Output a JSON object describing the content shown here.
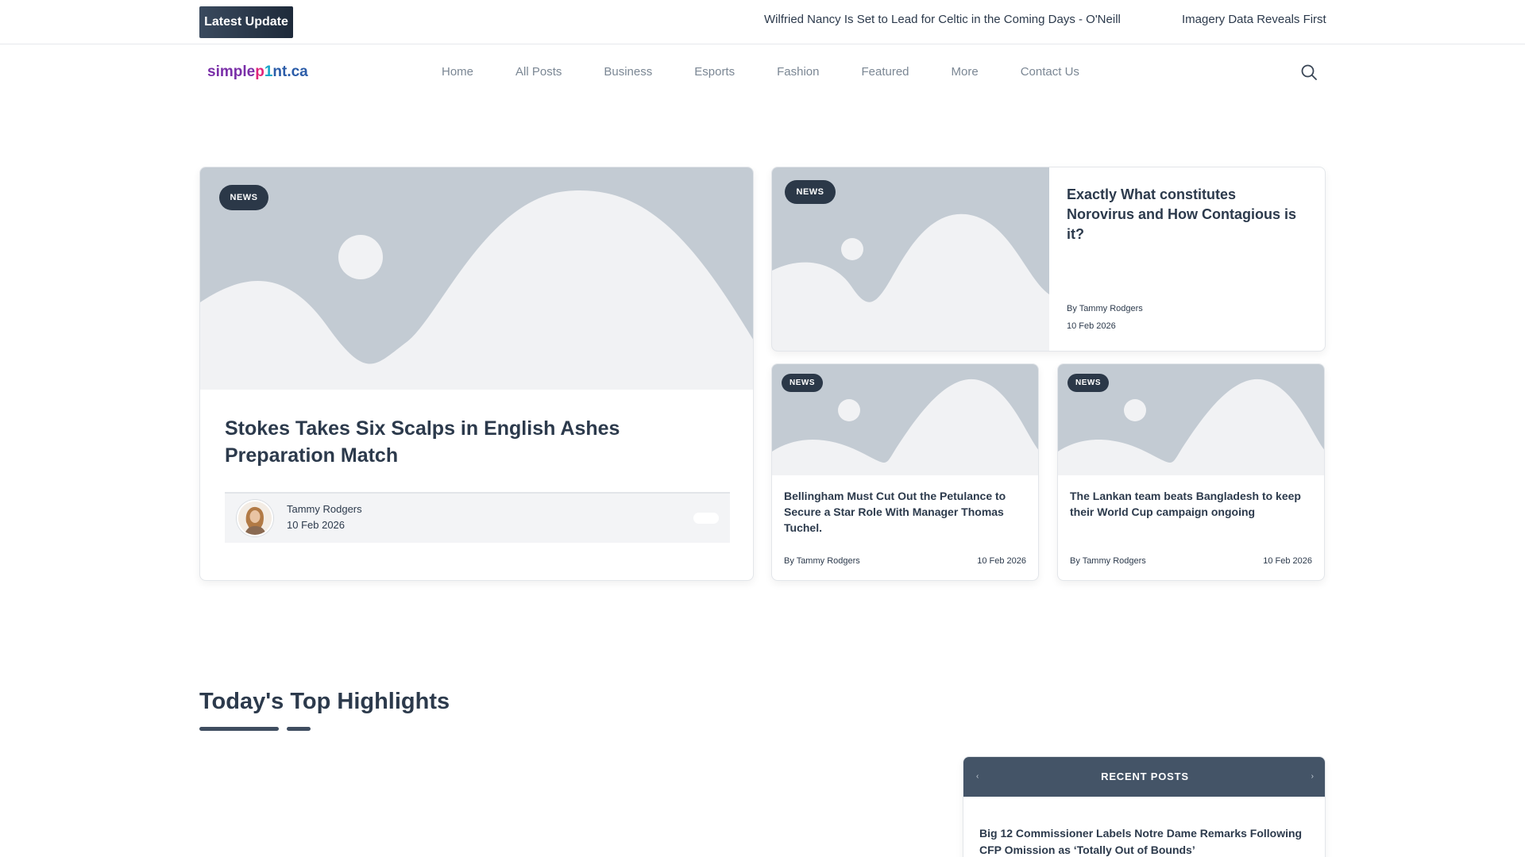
{
  "ticker": {
    "badge": "Latest Update",
    "items": [
      "Wilfried Nancy Is Set to Lead for Celtic in the Coming Days - O'Neill",
      "Imagery Data Reveals First"
    ]
  },
  "header": {
    "logo": {
      "part1": "simple",
      "part2": "p",
      "part3": "1",
      "part4": "nt.ca"
    },
    "nav": [
      "Home",
      "All Posts",
      "Business",
      "Esports",
      "Fashion",
      "Featured",
      "More",
      "Contact Us"
    ],
    "search_icon": "search-icon"
  },
  "featured": {
    "badge": "NEWS",
    "title": "Stokes Takes Six Scalps in English Ashes Preparation Match",
    "author": "Tammy Rodgers",
    "date": "10 Feb 2026"
  },
  "wide": {
    "badge": "NEWS",
    "title": "Exactly What constitutes Norovirus and How Contagious is it?",
    "by": "By Tammy Rodgers",
    "date": "10 Feb 2026"
  },
  "small": [
    {
      "badge": "NEWS",
      "title": "Bellingham Must Cut Out the Petulance to Secure a Star Role With Manager Thomas Tuchel.",
      "by": "By Tammy Rodgers",
      "date": "10 Feb 2026"
    },
    {
      "badge": "NEWS",
      "title": "The Lankan team beats Bangladesh to keep their World Cup campaign ongoing",
      "by": "By Tammy Rodgers",
      "date": "10 Feb 2026"
    }
  ],
  "highlights": {
    "title": "Today's Top Highlights"
  },
  "recent": {
    "title": "RECENT POSTS",
    "prev_icon": "chevron-left-icon",
    "next_icon": "chevron-right-icon",
    "prev_glyph": "‹",
    "next_glyph": "›",
    "first_post": "Big 12 Commissioner Labels Notre Dame Remarks Following CFP Omission as ‘Totally Out of Bounds’"
  },
  "colors": {
    "accent_dark": "#2b3848",
    "placeholder_bg": "#c3cbd3",
    "placeholder_shape": "#f1f2f4",
    "recent_header": "#445467"
  }
}
